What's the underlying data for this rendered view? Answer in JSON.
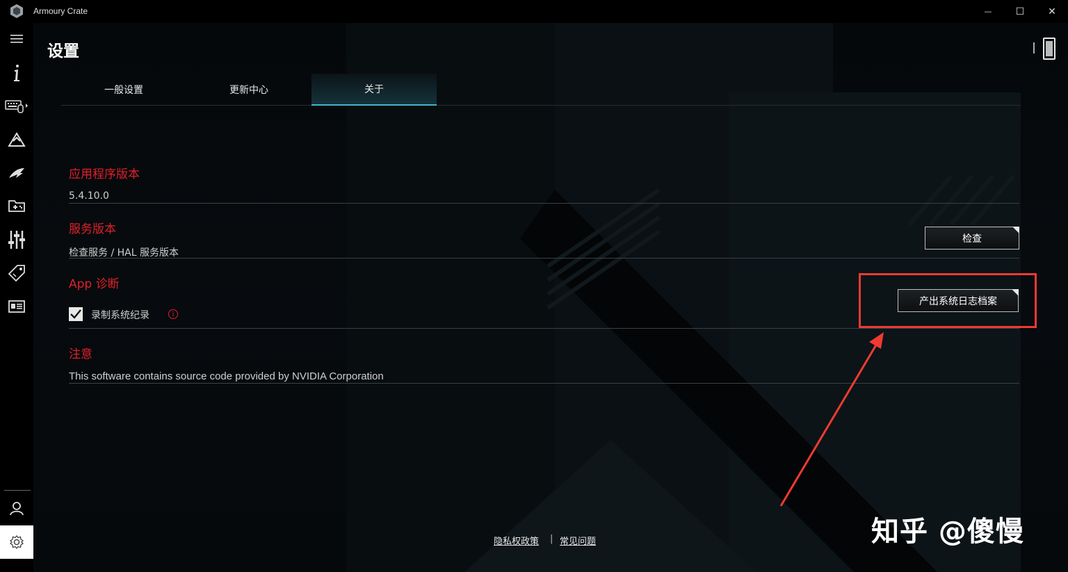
{
  "window": {
    "title": "Armoury Crate",
    "controls": {
      "minimize": "—",
      "maximize": "☐",
      "close": "✕"
    }
  },
  "sidebar": {
    "items": [
      {
        "name": "menu-icon"
      },
      {
        "name": "info-icon"
      },
      {
        "name": "keyboard-mouse-icon"
      },
      {
        "name": "aura-icon"
      },
      {
        "name": "rog-logo-icon"
      },
      {
        "name": "game-library-icon"
      },
      {
        "name": "sliders-icon"
      },
      {
        "name": "tag-icon"
      },
      {
        "name": "news-icon"
      },
      {
        "name": "user-icon"
      },
      {
        "name": "settings-icon"
      }
    ]
  },
  "header": {
    "title": "设置"
  },
  "tabs": [
    {
      "label": "一般设置",
      "active": false
    },
    {
      "label": "更新中心",
      "active": false
    },
    {
      "label": "关于",
      "active": true
    }
  ],
  "sections": {
    "app_version": {
      "title": "应用程序版本",
      "value": "5.4.10.0"
    },
    "service_version": {
      "title": "服务版本",
      "value": "检查服务 / HAL 服务版本",
      "button": "检查"
    },
    "diagnostics": {
      "title": "App 诊断",
      "checkbox_label": "录制系统纪录",
      "checked": true,
      "button": "产出系统日志档案"
    },
    "notice": {
      "title": "注意",
      "text": "This software contains source code provided by NVIDIA Corporation"
    }
  },
  "footer": {
    "privacy": "隐私权政策",
    "separator": "|",
    "faq": "常见问题"
  },
  "watermark": "知乎 @傻慢",
  "colors": {
    "accent_red": "#e0202a",
    "tab_active": "#3fb8c8",
    "annotation": "#f03a32"
  }
}
